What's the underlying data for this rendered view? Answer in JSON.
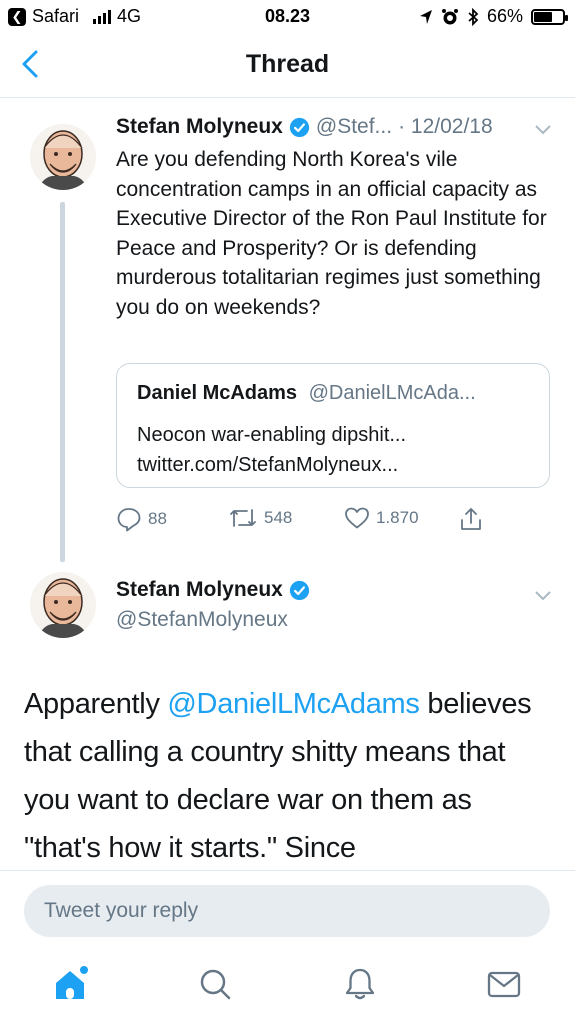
{
  "status_bar": {
    "back_app": "Safari",
    "network": "4G",
    "time": "08.23",
    "battery": "66%",
    "battery_level": 0.66
  },
  "nav": {
    "title": "Thread"
  },
  "tweet1": {
    "name": "Stefan Molyneux",
    "handle": "@Stef...",
    "date": "· 12/02/18",
    "text": "Are you defending North Korea's vile concentration camps in an official capacity as Executive Director of the Ron Paul Institute for Peace and Prosperity? Or is defending murderous totalitarian regimes just  something you do on weekends?",
    "quote": {
      "name": "Daniel McAdams",
      "handle": "@DanielLMcAda...",
      "line1": "Neocon war-enabling dipshit...",
      "line2": "twitter.com/StefanMolyneux..."
    },
    "replies": "88",
    "retweets": "548",
    "likes": "1.870"
  },
  "tweet2": {
    "name": "Stefan Molyneux",
    "handle": "@StefanMolyneux",
    "text_pre": "Apparently ",
    "mention": "@DanielLMcAdams",
    "text_post": " believes that calling a country shitty means that you want to declare war on them as \"that's how it starts.\" Since"
  },
  "reply": {
    "placeholder": "Tweet your reply"
  },
  "colors": {
    "accent": "#1da1f2",
    "secondary_text": "#657786",
    "border": "#e1e8ed"
  },
  "icons": [
    "back-chevron-icon",
    "verified-badge-icon",
    "chevron-down-icon",
    "reply-icon",
    "retweet-icon",
    "like-icon",
    "share-icon",
    "home-icon",
    "search-icon",
    "notifications-icon",
    "messages-icon"
  ]
}
